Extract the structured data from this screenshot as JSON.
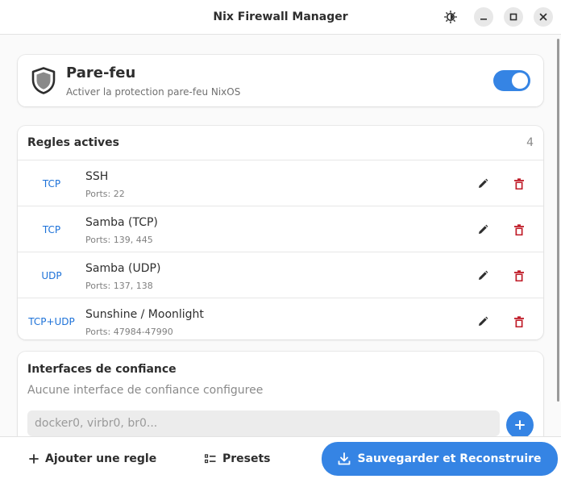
{
  "window": {
    "title": "Nix Firewall Manager"
  },
  "firewall": {
    "title": "Pare-feu",
    "subtitle": "Activer la protection pare-feu NixOS",
    "enabled": true
  },
  "rules": {
    "title": "Regles actives",
    "count": "4",
    "items": [
      {
        "protocol": "TCP",
        "name": "SSH",
        "ports": "Ports: 22"
      },
      {
        "protocol": "TCP",
        "name": "Samba (TCP)",
        "ports": "Ports: 139, 445"
      },
      {
        "protocol": "UDP",
        "name": "Samba (UDP)",
        "ports": "Ports: 137, 138"
      },
      {
        "protocol": "TCP+UDP",
        "name": "Sunshine / Moonlight",
        "ports": "Ports: 47984-47990"
      }
    ]
  },
  "interfaces": {
    "title": "Interfaces de confiance",
    "empty_text": "Aucune interface de confiance configuree",
    "input_placeholder": "docker0, virbr0, br0...",
    "input_value": ""
  },
  "bottom": {
    "add_rule_label": "Ajouter une regle",
    "presets_label": "Presets",
    "save_label": "Sauvegarder et Reconstruire"
  },
  "colors": {
    "accent": "#3584e4",
    "protocol_text": "#1c71d8",
    "delete": "#c01c28"
  },
  "icons": {
    "theme": "brightness-icon",
    "minimize": "minimize-icon",
    "maximize": "maximize-icon",
    "close": "close-icon",
    "shield": "shield-icon",
    "edit": "pencil-icon",
    "delete": "trash-icon",
    "add": "plus-icon",
    "presets": "list-icon",
    "save": "download-icon"
  }
}
